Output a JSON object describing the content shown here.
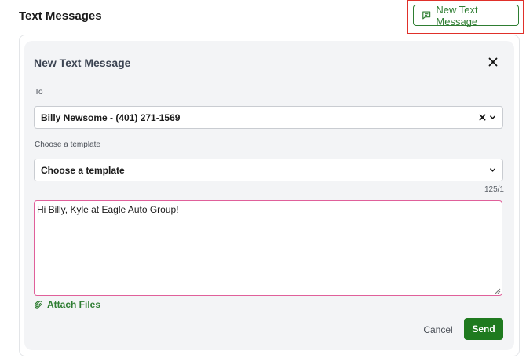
{
  "header": {
    "title": "Text Messages",
    "new_button_label": "New Text Message",
    "new_button_icon": "message-square-icon",
    "highlight_color": "#e0302a"
  },
  "dialog": {
    "title": "New Text Message",
    "close_icon": "close-icon",
    "to": {
      "label": "To",
      "value": "Billy Newsome - (401) 271-1569"
    },
    "template": {
      "label": "Choose a template",
      "value": "Choose a template"
    },
    "counter": "125/1",
    "message": "Hi Billy, Kyle at Eagle Auto Group!",
    "attach_label": "Attach Files",
    "attach_icon": "paperclip-icon",
    "cancel_label": "Cancel",
    "send_label": "Send"
  },
  "colors": {
    "accent": "#2e7d32",
    "send_bg": "#1f7a1f",
    "message_border": "#e0609a"
  }
}
